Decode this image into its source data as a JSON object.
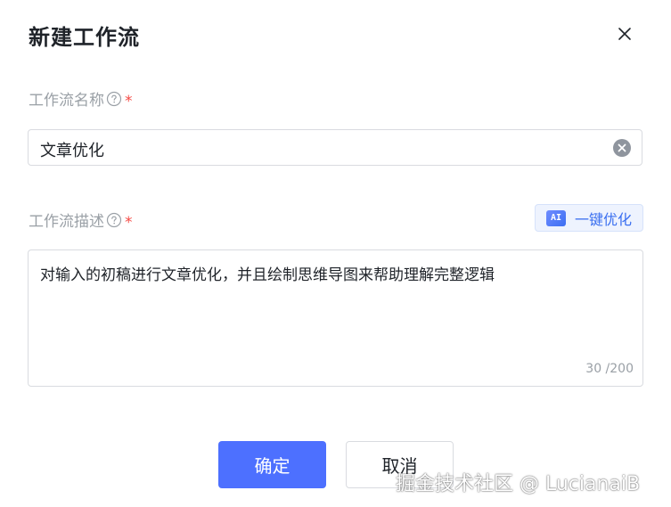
{
  "dialog": {
    "title": "新建工作流",
    "close_icon": "close-icon"
  },
  "form": {
    "name_field": {
      "label": "工作流名称",
      "help_icon": "question-circle-icon",
      "required_mark": "*",
      "value": "文章优化",
      "clear_icon": "clear-circle-icon"
    },
    "description_field": {
      "label": "工作流描述",
      "help_icon": "question-circle-icon",
      "required_mark": "*",
      "value": "对输入的初稿进行文章优化，并且绘制思维导图来帮助理解完整逻辑",
      "counter": "30 /200"
    },
    "ai_optimize": {
      "badge": "AI",
      "label": "一键优化"
    }
  },
  "footer": {
    "confirm_label": "确定",
    "cancel_label": "取消"
  },
  "watermark": "掘金技术社区 @ LucianaiB",
  "colors": {
    "primary": "#4d70ff",
    "required": "#f54a45",
    "ai_accent": "#3a6ff0",
    "border": "#d9dbe0",
    "muted": "#9aa0a6"
  }
}
